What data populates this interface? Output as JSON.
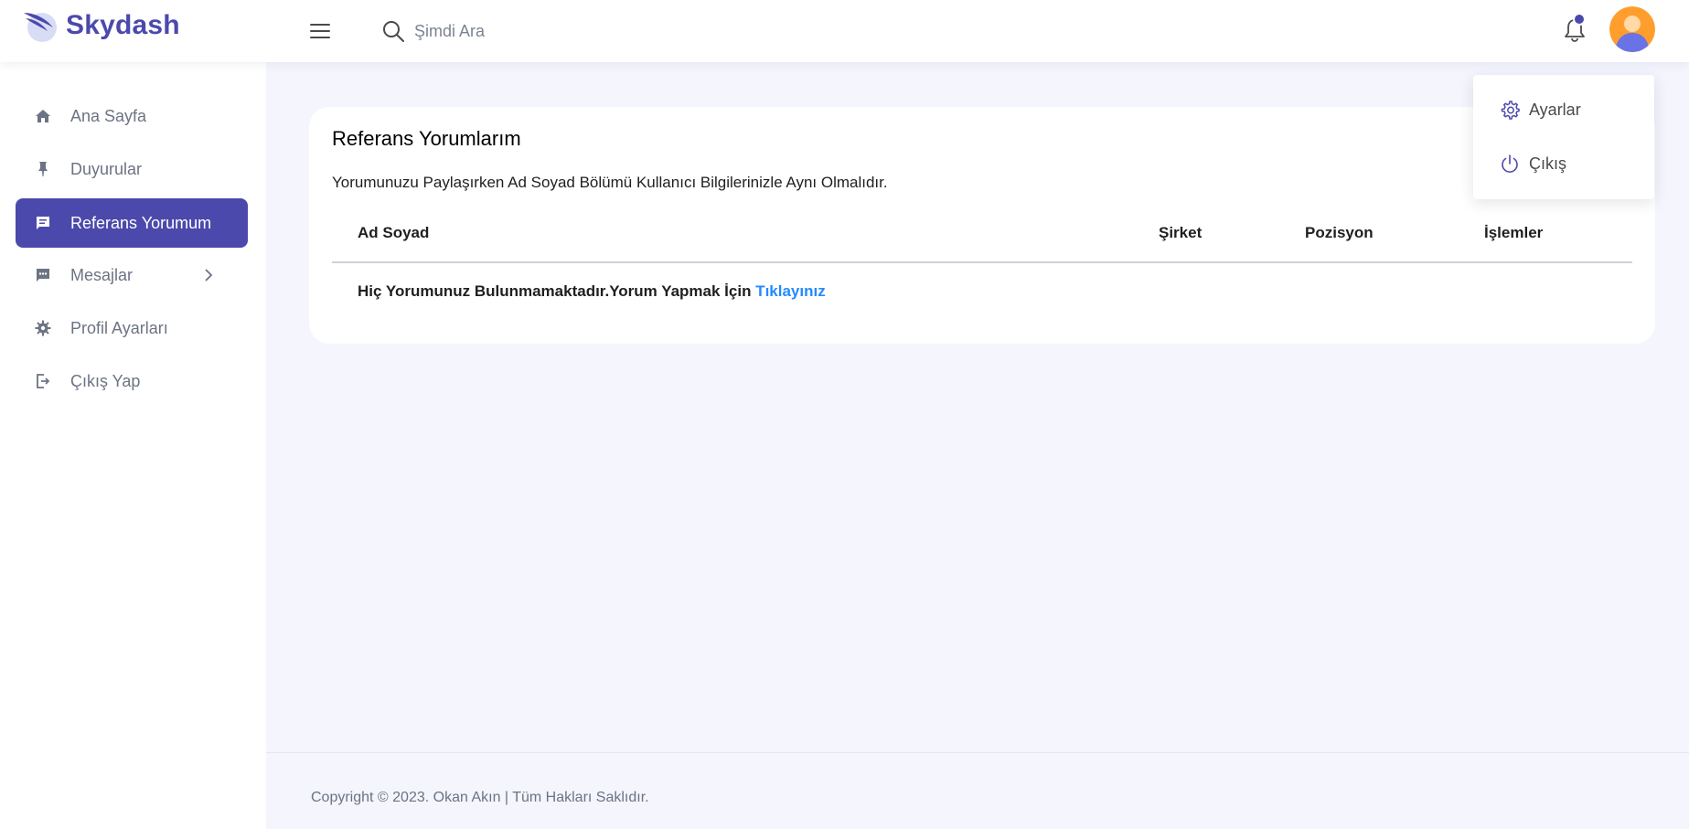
{
  "brand": {
    "name": "Skydash",
    "color": "#4b49ac"
  },
  "search": {
    "placeholder": "Şimdi Ara",
    "value": ""
  },
  "header_icons": {
    "menu": "hamburger-icon",
    "search": "search-icon",
    "notifications": "bell-icon",
    "avatar": "user-avatar"
  },
  "sidebar": {
    "items": [
      {
        "label": "Ana Sayfa",
        "icon": "home-icon"
      },
      {
        "label": "Duyurular",
        "icon": "pin-icon"
      },
      {
        "label": "Referans Yorumum",
        "icon": "comment-icon",
        "active": true
      },
      {
        "label": "Mesajlar",
        "icon": "message-icon",
        "has_submenu": true
      },
      {
        "label": "Profil Ayarları",
        "icon": "gear-icon"
      },
      {
        "label": "Çıkış Yap",
        "icon": "logout-icon"
      }
    ]
  },
  "main": {
    "card": {
      "title": "Referans Yorumlarım",
      "description": "Yorumunuzu Paylaşırken Ad Soyad Bölümü Kullanıcı Bilgilerinizle Aynı Olmalıdır.",
      "table": {
        "columns": [
          "Ad Soyad",
          "Şirket",
          "Pozisyon",
          "İşlemler"
        ],
        "empty_message": "Hiç Yorumunuz Bulunmamaktadır.Yorum Yapmak İçin ",
        "empty_link": "Tıklayınız"
      }
    }
  },
  "profile_dropdown": {
    "items": [
      {
        "label": "Ayarlar",
        "icon": "settings-icon"
      },
      {
        "label": "Çıkış",
        "icon": "power-icon"
      }
    ]
  },
  "footer": {
    "text": "Copyright © 2023. Okan Akın | Tüm Hakları Saklıdır."
  },
  "colors": {
    "primary": "#4b49ac",
    "link": "#248afd",
    "background": "#f4f5fd",
    "muted_text": "#6c7383"
  }
}
